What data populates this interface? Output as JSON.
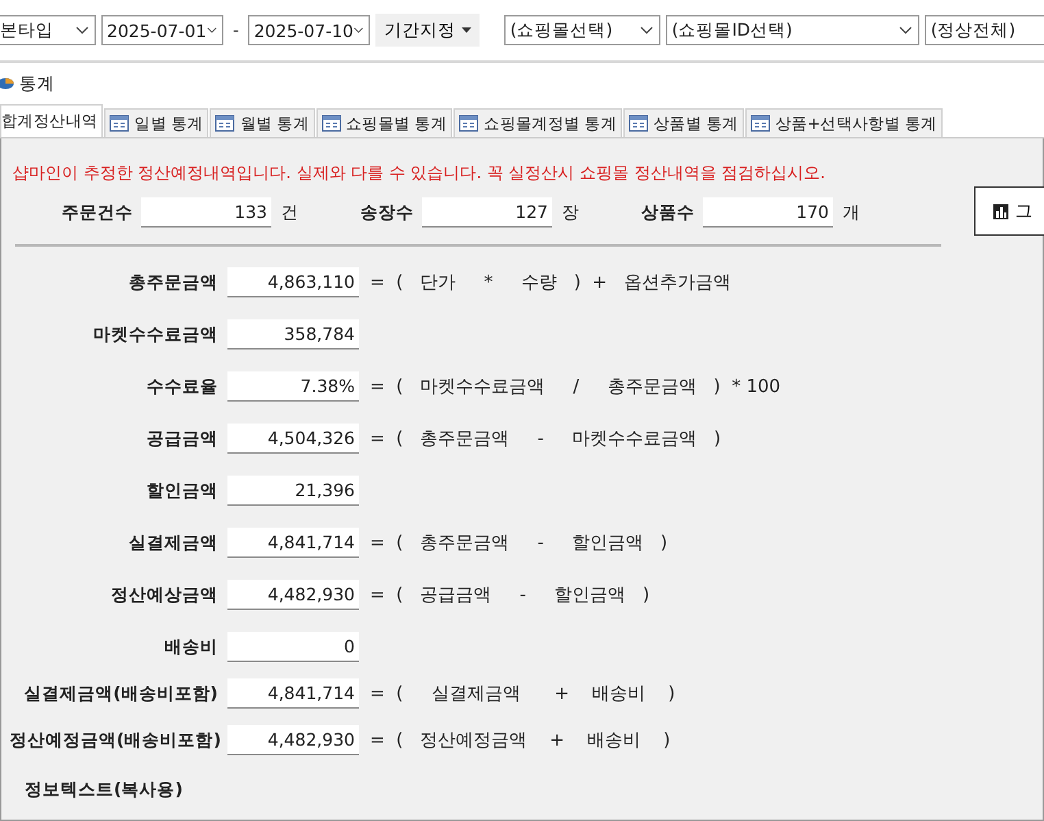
{
  "toolbar": {
    "type_select": "본타입",
    "date_from": "2025-07-01",
    "date_sep": "-",
    "date_to": "2025-07-10",
    "period_button": "기간지정",
    "mall_select": "(쇼핑몰선택)",
    "mall_id_select": "(쇼핑몰ID선택)",
    "status_select": "(정상전체)"
  },
  "panel": {
    "title": "통계"
  },
  "tabs": [
    {
      "label": "합계정산내역",
      "selected": true
    },
    {
      "label": "일별 통계",
      "selected": false
    },
    {
      "label": "월별 통계",
      "selected": false
    },
    {
      "label": "쇼핑몰별 통계",
      "selected": false
    },
    {
      "label": "쇼핑몰계정별 통계",
      "selected": false
    },
    {
      "label": "상품별 통계",
      "selected": false
    },
    {
      "label": "상품+선택사항별 통계",
      "selected": false
    }
  ],
  "notice": "샵마인이 추정한 정산예정내역입니다. 실제와 다를 수 있습니다. 꼭 실정산시 쇼핑몰 정산내역을 점검하십시오.",
  "counts": [
    {
      "label": "주문건수",
      "value": "133",
      "unit": "건"
    },
    {
      "label": "송장수",
      "value": "127",
      "unit": "장"
    },
    {
      "label": "상품수",
      "value": "170",
      "unit": "개"
    }
  ],
  "side_button": {
    "label": "그"
  },
  "formulas": [
    {
      "label": "총주문금액",
      "value": "4,863,110",
      "formula": "=  (   단가     *     수량   )  +   옵션추가금액"
    },
    {
      "label": "마켓수수료금액",
      "value": "358,784"
    },
    {
      "label": "수수료율",
      "value": "7.38%",
      "formula": "=  (   마켓수수료금액     /     총주문금액   )  * 100"
    },
    {
      "label": "공급금액",
      "value": "4,504,326",
      "formula": "=  (   총주문금액     -     마켓수수료금액   )"
    },
    {
      "label": "할인금액",
      "value": "21,396"
    },
    {
      "label": "실결제금액",
      "value": "4,841,714",
      "formula": "=  (   총주문금액     -     할인금액   )"
    },
    {
      "label": "정산예상금액",
      "value": "4,482,930",
      "formula": "=  (   공급금액     -     할인금액   )"
    },
    {
      "label": "배송비",
      "value": "0"
    },
    {
      "label": "실결제금액(배송비포함)",
      "value": "4,841,714",
      "formula": "=  (     실결제금액      +    배송비    )"
    },
    {
      "label": "정산예정금액(배송비포함)",
      "value": "4,482,930",
      "formula": "=  (   정산예정금액    +    배송비    )"
    }
  ],
  "footer_label": "정보텍스트(복사용)"
}
